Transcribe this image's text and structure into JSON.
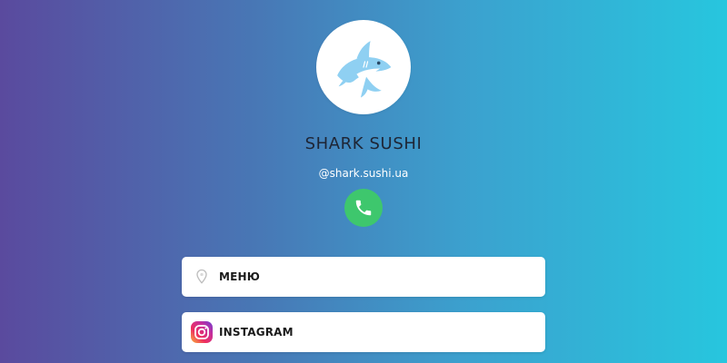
{
  "profile": {
    "name": "SHARK SUSHI",
    "handle": "@shark.sushi.ua",
    "avatar_icon": "shark-icon"
  },
  "actions": {
    "phone_icon": "phone-icon",
    "phone_color": "#3ec76d"
  },
  "links": [
    {
      "label": "МЕНЮ",
      "icon": "map-pin-icon"
    },
    {
      "label": "INSTAGRAM",
      "icon": "instagram-icon"
    }
  ],
  "colors": {
    "gradient_start": "#5a4a9e",
    "gradient_end": "#27c6de",
    "card_bg": "#ffffff",
    "avatar_accent": "#8fd0f2"
  }
}
